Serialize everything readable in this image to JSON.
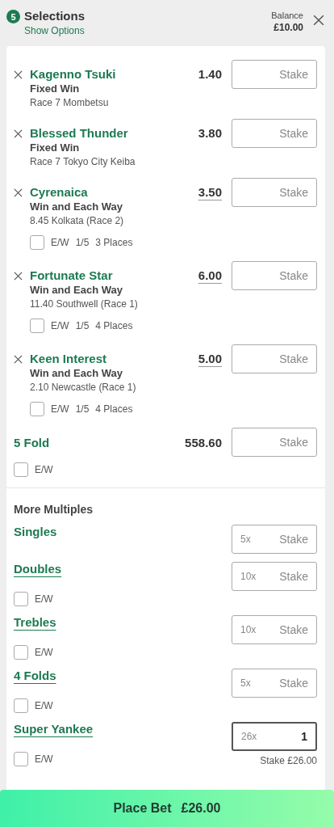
{
  "header": {
    "count": "5",
    "title": "Selections",
    "options_link": "Show Options",
    "balance_label": "Balance",
    "balance": "£10.00"
  },
  "selections": [
    {
      "name": "Kagenno Tsuki",
      "market": "Fixed Win",
      "event": "Race 7 Mombetsu",
      "odds": "1.40",
      "odds_underlined": false,
      "stake_placeholder": "Stake"
    },
    {
      "name": "Blessed Thunder",
      "market": "Fixed Win",
      "event": "Race 7 Tokyo City Keiba",
      "odds": "3.80",
      "odds_underlined": false,
      "stake_placeholder": "Stake"
    },
    {
      "name": "Cyrenaica",
      "market": "Win and Each Way",
      "event": "8.45 Kolkata (Race 2)",
      "odds": "3.50",
      "odds_underlined": true,
      "stake_placeholder": "Stake",
      "each_way": {
        "checked": false,
        "label": "E/W",
        "terms": "1/5",
        "places": "3 Places"
      }
    },
    {
      "name": "Fortunate Star",
      "market": "Win and Each Way",
      "event": "11.40 Southwell (Race 1)",
      "odds": "6.00",
      "odds_underlined": true,
      "stake_placeholder": "Stake",
      "each_way": {
        "checked": false,
        "label": "E/W",
        "terms": "1/5",
        "places": "4 Places"
      }
    },
    {
      "name": "Keen Interest",
      "market": "Win and Each Way",
      "event": "2.10 Newcastle (Race 1)",
      "odds": "5.00",
      "odds_underlined": true,
      "stake_placeholder": "Stake",
      "each_way": {
        "checked": false,
        "label": "E/W",
        "terms": "1/5",
        "places": "4 Places"
      }
    }
  ],
  "fold": {
    "name": "5 Fold",
    "odds": "558.60",
    "stake_placeholder": "Stake",
    "each_way": {
      "checked": false,
      "label": "E/W"
    }
  },
  "multiples": {
    "title": "More Multiples",
    "items": [
      {
        "name": "Singles",
        "underlined": false,
        "count": "5x",
        "stake_placeholder": "Stake",
        "focused": false
      },
      {
        "name": "Doubles",
        "underlined": true,
        "count": "10x",
        "stake_placeholder": "Stake",
        "focused": false,
        "each_way": {
          "checked": false,
          "label": "E/W"
        }
      },
      {
        "name": "Trebles",
        "underlined": true,
        "count": "10x",
        "stake_placeholder": "Stake",
        "focused": false,
        "each_way": {
          "checked": false,
          "label": "E/W"
        }
      },
      {
        "name": "4 Folds",
        "underlined": true,
        "count": "5x",
        "stake_placeholder": "Stake",
        "focused": false,
        "each_way": {
          "checked": false,
          "label": "E/W"
        }
      },
      {
        "name": "Super Yankee",
        "underlined": true,
        "count": "26x",
        "value": "1",
        "focused": true,
        "total": "Stake £26.00",
        "each_way": {
          "checked": false,
          "label": "E/W"
        }
      }
    ]
  },
  "place_bet": {
    "label": "Place Bet",
    "amount": "£26.00"
  }
}
